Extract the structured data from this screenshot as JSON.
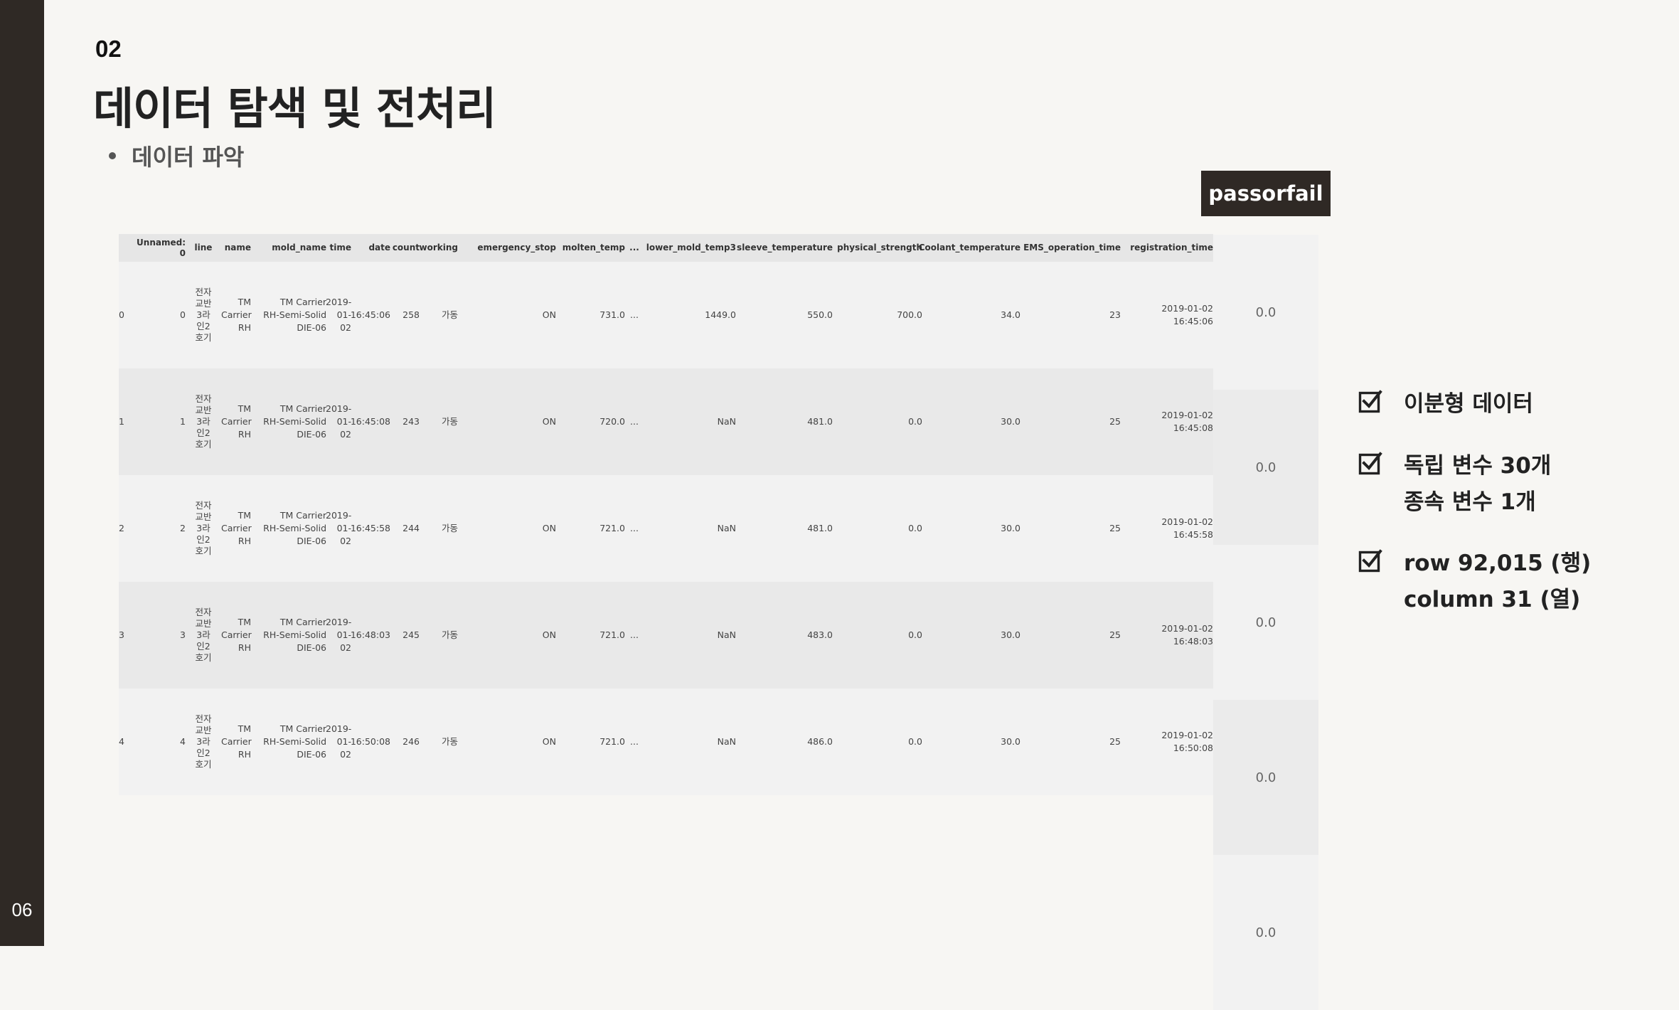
{
  "slide": {
    "page_number": "06",
    "section_number": "02",
    "title": "데이터 탐색 및 전처리",
    "bullet": "데이터 파악"
  },
  "dataframe": {
    "columns": [
      "",
      "Unnamed: 0",
      "line",
      "name",
      "mold_name",
      "time",
      "date",
      "count",
      "working",
      "emergency_stop",
      "molten_temp",
      "...",
      "lower_mold_temp3",
      "sleeve_temperature",
      "physical_strength",
      "Coolant_temperature",
      "EMS_operation_time",
      "registration_time"
    ],
    "rows": [
      [
        "0",
        "0",
        "전자교반3라인2호기",
        "TM Carrier RH",
        "TM Carrier RH-Semi-Solid DIE-06",
        "2019-01-02",
        "16:45:06",
        "258",
        "가동",
        "ON",
        "731.0",
        "...",
        "1449.0",
        "550.0",
        "700.0",
        "34.0",
        "23",
        "2019-01-02 16:45:06"
      ],
      [
        "1",
        "1",
        "전자교반3라인2호기",
        "TM Carrier RH",
        "TM Carrier RH-Semi-Solid DIE-06",
        "2019-01-02",
        "16:45:08",
        "243",
        "가동",
        "ON",
        "720.0",
        "...",
        "NaN",
        "481.0",
        "0.0",
        "30.0",
        "25",
        "2019-01-02 16:45:08"
      ],
      [
        "2",
        "2",
        "전자교반3라인2호기",
        "TM Carrier RH",
        "TM Carrier RH-Semi-Solid DIE-06",
        "2019-01-02",
        "16:45:58",
        "244",
        "가동",
        "ON",
        "721.0",
        "...",
        "NaN",
        "481.0",
        "0.0",
        "30.0",
        "25",
        "2019-01-02 16:45:58"
      ],
      [
        "3",
        "3",
        "전자교반3라인2호기",
        "TM Carrier RH",
        "TM Carrier RH-Semi-Solid DIE-06",
        "2019-01-02",
        "16:48:03",
        "245",
        "가동",
        "ON",
        "721.0",
        "...",
        "NaN",
        "483.0",
        "0.0",
        "30.0",
        "25",
        "2019-01-02 16:48:03"
      ],
      [
        "4",
        "4",
        "전자교반3라인2호기",
        "TM Carrier RH",
        "TM Carrier RH-Semi-Solid DIE-06",
        "2019-01-02",
        "16:50:08",
        "246",
        "가동",
        "ON",
        "721.0",
        "...",
        "NaN",
        "486.0",
        "0.0",
        "30.0",
        "25",
        "2019-01-02 16:50:08"
      ]
    ]
  },
  "passorfail": {
    "header": "passorfail",
    "values": [
      "0.0",
      "0.0",
      "0.0",
      "0.0",
      "0.0"
    ]
  },
  "checklist": [
    {
      "lines": [
        "이분형 데이터"
      ]
    },
    {
      "lines": [
        "독립 변수 30개",
        "종속 변수 1개"
      ]
    },
    {
      "lines": [
        "row 92,015 (행)",
        "column 31 (열)"
      ]
    }
  ],
  "colors": {
    "sidebar": "#2f2925",
    "background": "#f7f6f3",
    "accent_header": "#2f2925"
  }
}
